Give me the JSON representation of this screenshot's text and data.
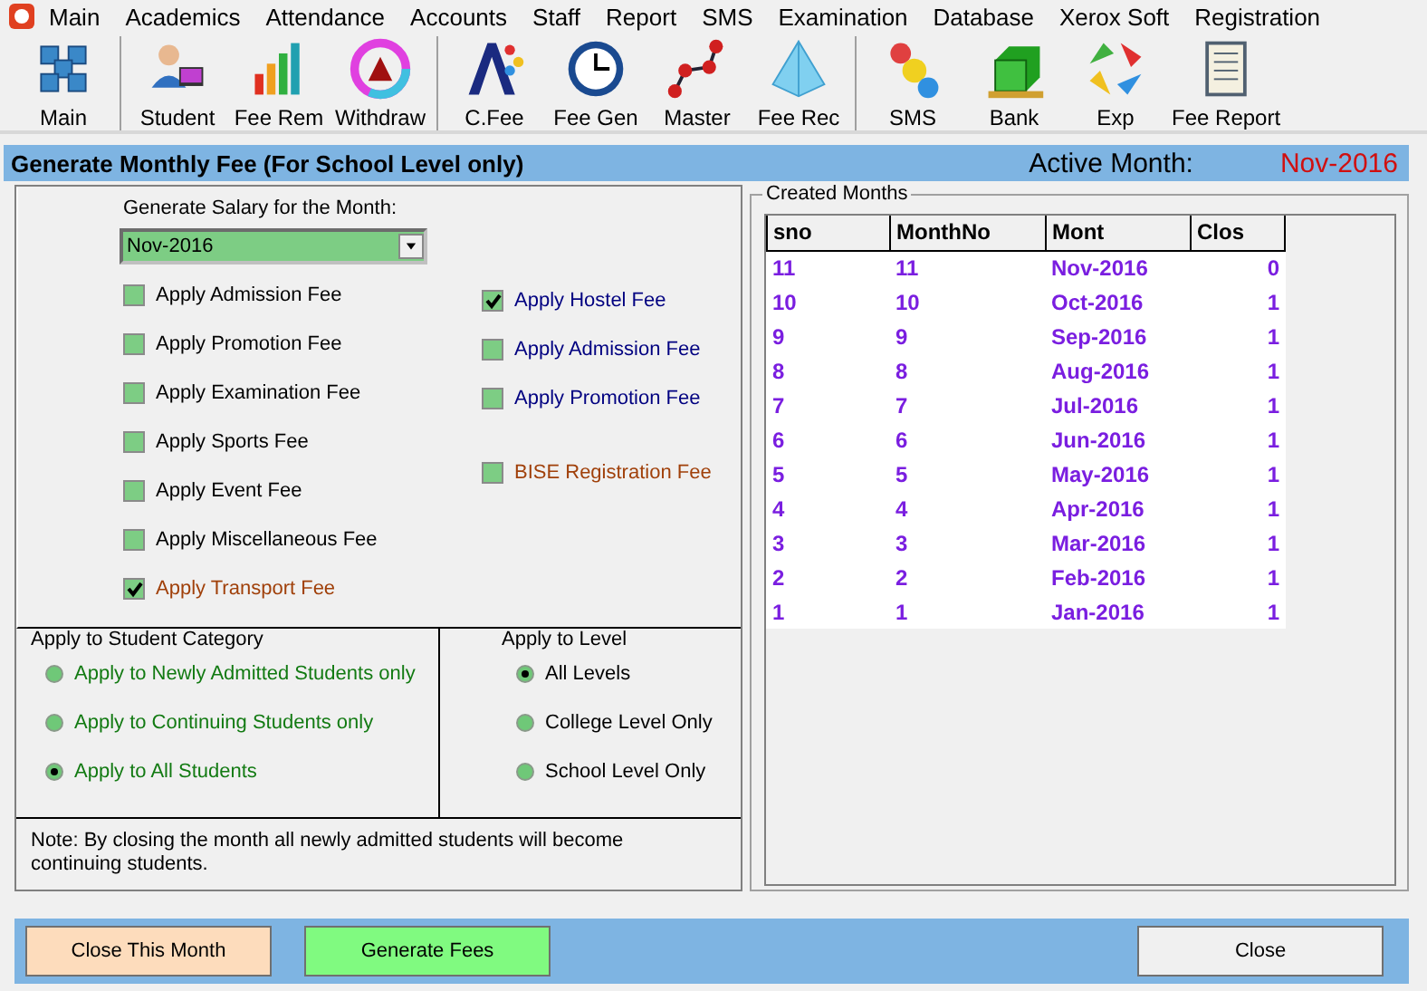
{
  "menu": [
    "Main",
    "Academics",
    "Attendance",
    "Accounts",
    "Staff",
    "Report",
    "SMS",
    "Examination",
    "Database",
    "Xerox Soft",
    "Registration"
  ],
  "toolbar": {
    "groups": [
      [
        {
          "label": "Main"
        }
      ],
      [
        {
          "label": "Student"
        },
        {
          "label": "Fee Rem"
        },
        {
          "label": "Withdraw"
        }
      ],
      [
        {
          "label": "C.Fee"
        },
        {
          "label": "Fee Gen"
        },
        {
          "label": "Master"
        },
        {
          "label": "Fee Rec"
        }
      ],
      [
        {
          "label": "SMS"
        },
        {
          "label": "Bank"
        },
        {
          "label": "Exp"
        },
        {
          "label": "Fee Report"
        }
      ]
    ]
  },
  "header": {
    "title": "Generate Monthly Fee (For School Level only)",
    "active_label": "Active Month:",
    "active_value": "Nov-2016"
  },
  "month_label": "Generate Salary for the Month:",
  "month_select": {
    "value": "Nov-2016"
  },
  "fees_left": [
    {
      "label": "Apply Admission Fee",
      "checked": false,
      "color": "#000000"
    },
    {
      "label": "Apply Promotion  Fee",
      "checked": false,
      "color": "#000000"
    },
    {
      "label": "Apply Examination Fee",
      "checked": false,
      "color": "#000000"
    },
    {
      "label": "Apply Sports Fee",
      "checked": false,
      "color": "#000000"
    },
    {
      "label": "Apply Event Fee",
      "checked": false,
      "color": "#000000"
    },
    {
      "label": "Apply Miscellaneous Fee",
      "checked": false,
      "color": "#000000"
    },
    {
      "label": "Apply Transport Fee",
      "checked": true,
      "color": "#a0400a"
    }
  ],
  "fees_right": [
    {
      "label": "Apply Hostel Fee",
      "checked": true,
      "color": "#000080"
    },
    {
      "label": "Apply Admission Fee",
      "checked": false,
      "color": "#000080"
    },
    {
      "label": "Apply Promotion Fee",
      "checked": false,
      "color": "#000080"
    },
    {
      "label": "BISE Registration Fee",
      "checked": false,
      "color": "#a0400a"
    }
  ],
  "category": {
    "title": "Apply to Student Category",
    "options": [
      {
        "label": "Apply to Newly Admitted Students only",
        "selected": false
      },
      {
        "label": "Apply to Continuing Students only",
        "selected": false
      },
      {
        "label": "Apply to All Students",
        "selected": true
      }
    ]
  },
  "level": {
    "title": "Apply to Level",
    "options": [
      {
        "label": "All Levels",
        "selected": true
      },
      {
        "label": "College Level Only",
        "selected": false
      },
      {
        "label": "School  Level Only",
        "selected": false
      }
    ]
  },
  "note": "Note: By closing the month all newly admitted students will become continuing students.",
  "created_months": {
    "title": "Created Months",
    "columns": [
      "sno",
      "MonthNo",
      "Mont",
      "Clos"
    ],
    "rows": [
      [
        "11",
        "11",
        "Nov-2016",
        "0"
      ],
      [
        "10",
        "10",
        "Oct-2016",
        "1"
      ],
      [
        "9",
        "9",
        "Sep-2016",
        "1"
      ],
      [
        "8",
        "8",
        "Aug-2016",
        "1"
      ],
      [
        "7",
        "7",
        "Jul-2016",
        "1"
      ],
      [
        "6",
        "6",
        "Jun-2016",
        "1"
      ],
      [
        "5",
        "5",
        "May-2016",
        "1"
      ],
      [
        "4",
        "4",
        "Apr-2016",
        "1"
      ],
      [
        "3",
        "3",
        "Mar-2016",
        "1"
      ],
      [
        "2",
        "2",
        "Feb-2016",
        "1"
      ],
      [
        "1",
        "1",
        "Jan-2016",
        "1"
      ]
    ]
  },
  "buttons": {
    "close_month": "Close This Month",
    "generate": "Generate Fees",
    "close": "Close"
  }
}
